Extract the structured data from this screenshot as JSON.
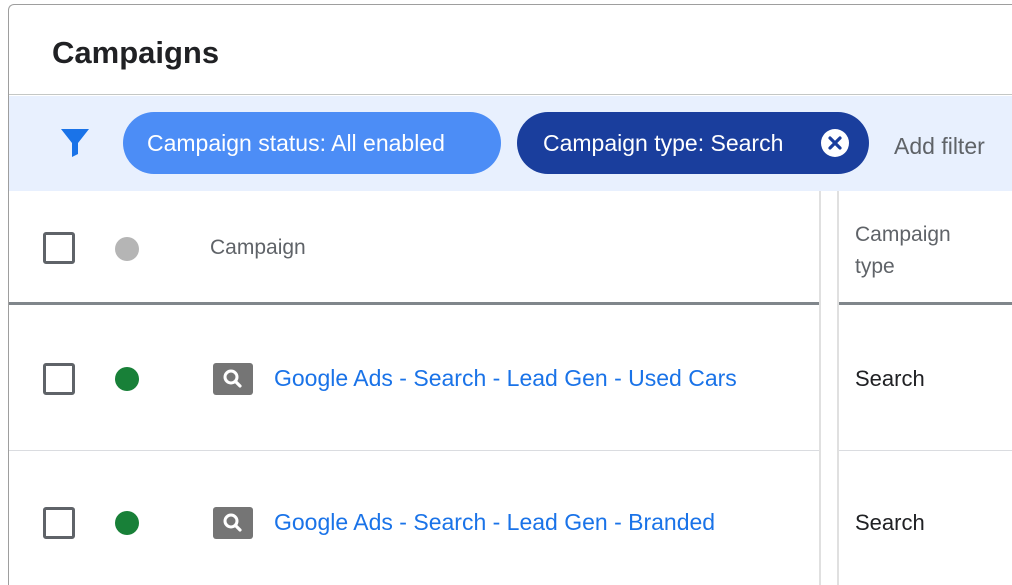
{
  "page": {
    "title": "Campaigns"
  },
  "filters": {
    "icon": "filter-funnel-icon",
    "chips": [
      {
        "label": "Campaign status: All enabled",
        "color": "#4c8df6"
      },
      {
        "label": "Campaign type: Search",
        "color": "#1a3e9d",
        "removable": true,
        "remove_icon": "close-circle-icon"
      }
    ],
    "add_filter_label": "Add filter"
  },
  "table": {
    "columns": {
      "campaign": "Campaign",
      "campaign_type_line1": "Campaign",
      "campaign_type_line2": "type"
    },
    "rows": [
      {
        "status": "enabled",
        "status_color": "#188038",
        "icon": "search-icon",
        "name": "Google Ads - Search - Lead Gen - Used Cars",
        "type": "Search"
      },
      {
        "status": "enabled",
        "status_color": "#188038",
        "icon": "search-icon",
        "name": "Google Ads - Search - Lead Gen - Branded",
        "type": "Search"
      }
    ]
  },
  "colors": {
    "filter_bar_bg": "#e8f0fe",
    "link": "#1a73e8",
    "status_header_dot": "#b5b5b5"
  }
}
